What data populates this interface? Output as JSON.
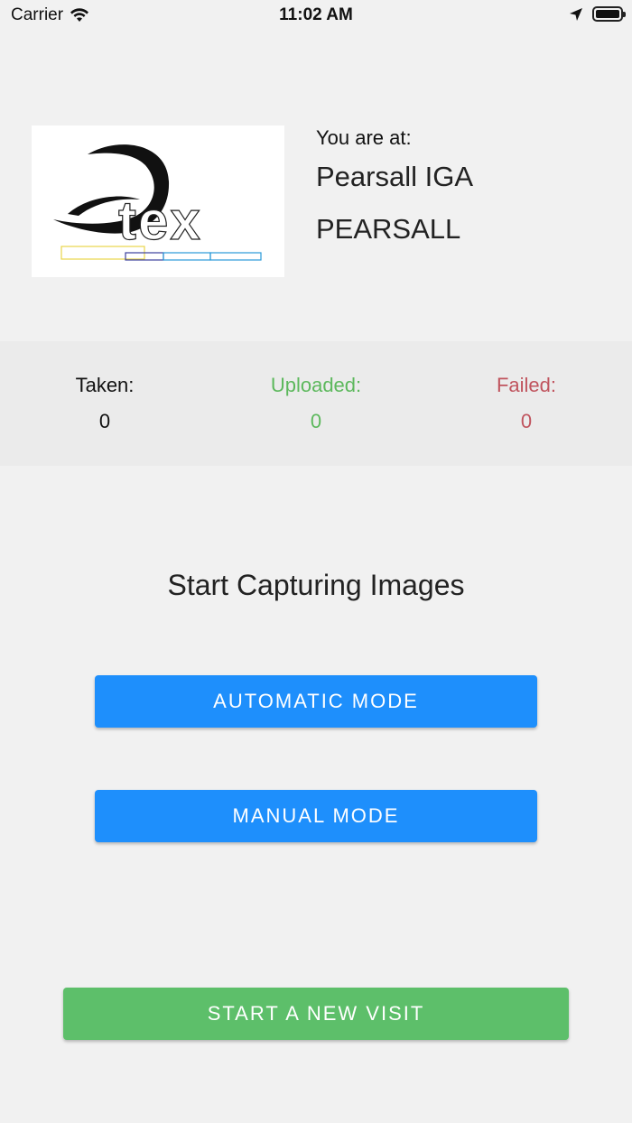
{
  "status_bar": {
    "carrier": "Carrier",
    "time": "11:02 AM",
    "icons": [
      "wifi-icon",
      "location-arrow-icon",
      "battery-icon"
    ]
  },
  "logo": {
    "text": "tex"
  },
  "location": {
    "label": "You are at:",
    "name": "Pearsall IGA",
    "city": "PEARSALL"
  },
  "stats": {
    "taken": {
      "label": "Taken:",
      "value": "0",
      "color": "#111111"
    },
    "uploaded": {
      "label": "Uploaded:",
      "value": "0",
      "color": "#5cb85c"
    },
    "failed": {
      "label": "Failed:",
      "value": "0",
      "color": "#c0545e"
    }
  },
  "capture": {
    "title": "Start Capturing Images",
    "automatic_label": "AUTOMATIC MODE",
    "manual_label": "MANUAL MODE",
    "button_color": "#1e8ffc"
  },
  "footer": {
    "new_visit_label": "START A NEW VISIT",
    "button_color": "#5dbf6a"
  }
}
